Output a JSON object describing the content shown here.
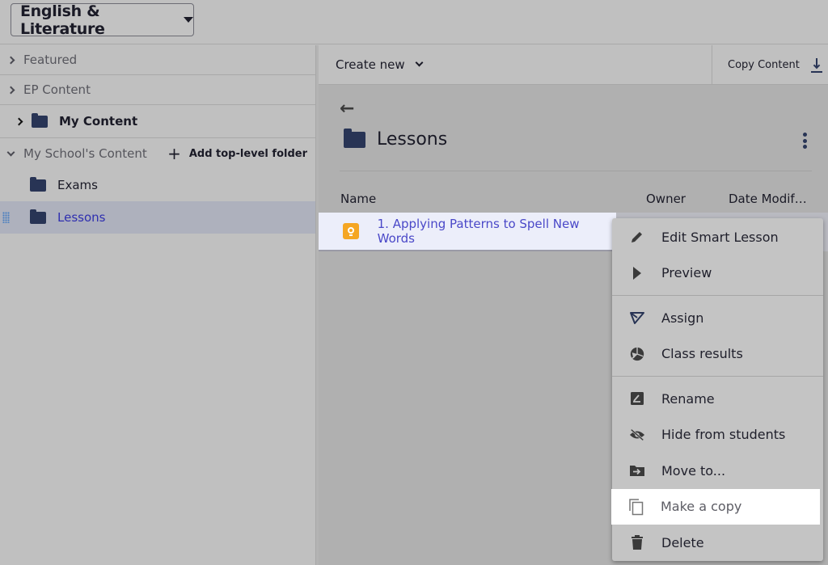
{
  "topbar": {
    "subject_select": "English & Literature"
  },
  "sidebar": {
    "sections": [
      {
        "label": "Featured",
        "expanded": false
      },
      {
        "label": "EP Content",
        "expanded": false
      },
      {
        "label": "My Content",
        "expanded": false
      }
    ],
    "school": {
      "label": "My School's Content",
      "expanded": true,
      "add_folder_label": "Add top-level folder",
      "items": [
        {
          "label": "Exams",
          "selected": false
        },
        {
          "label": "Lessons",
          "selected": true
        }
      ]
    }
  },
  "toolbar": {
    "create_new": "Create new",
    "copy_content": "Copy Content"
  },
  "folder": {
    "title": "Lessons",
    "columns": {
      "name": "Name",
      "owner": "Owner",
      "date": "Date Modif…"
    },
    "rows": [
      {
        "title": "1. Applying Patterns to Spell New Words",
        "type": "smart-lesson",
        "icon_color": "#f5a623"
      }
    ]
  },
  "context_menu": {
    "items": [
      {
        "label": "Edit Smart Lesson",
        "icon": "pencil-icon"
      },
      {
        "label": "Preview",
        "icon": "play-icon"
      },
      {
        "label": "Assign",
        "icon": "send-icon"
      },
      {
        "label": "Class results",
        "icon": "pie-chart-icon"
      },
      {
        "label": "Rename",
        "icon": "rename-icon"
      },
      {
        "label": "Hide from students",
        "icon": "eye-off-icon"
      },
      {
        "label": "Move to...",
        "icon": "folder-move-icon"
      },
      {
        "label": "Make a copy",
        "icon": "copy-icon",
        "highlighted": true
      },
      {
        "label": "Delete",
        "icon": "trash-icon"
      }
    ]
  },
  "colors": {
    "accent_link": "#4a48c8",
    "folder_icon": "#283455",
    "lesson_badge": "#f5a623",
    "selected_row": "#eceefa"
  }
}
